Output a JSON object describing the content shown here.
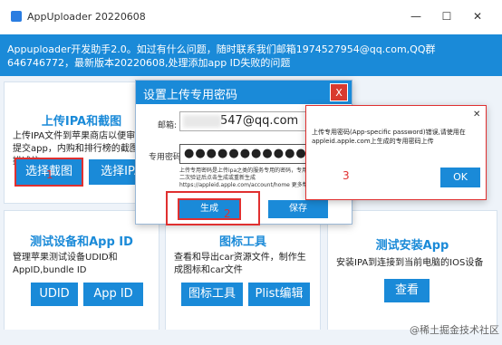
{
  "window": {
    "title": "AppUploader 20220608",
    "minimize": "—",
    "maximize": "☐",
    "close": "✕"
  },
  "banner": {
    "text": "Appuploader开发助手2.0。如过有什么问题，随时联系我们邮箱1974527954@qq.com,QQ群646746772，最新版本20220608,处理添加app ID失败的问题"
  },
  "cards": {
    "upload": {
      "title": "上传IPA和截图",
      "desc": "上传IPA文件到苹果商店以便审核提交app，内购和排行榜的截图和描述信",
      "button_screenshot": "选择截图",
      "button_ipa": "选择IPA"
    },
    "devices": {
      "title": "测试设备和App ID",
      "desc": "管理苹果测试设备UDID和AppID,bundle ID",
      "button_udid": "UDID",
      "button_appid": "App ID"
    },
    "icons": {
      "title": "图标工具",
      "desc": "查看和导出car资源文件，制作生成图标和car文件",
      "button_icon": "图标工具",
      "button_plist": "Plist编辑"
    },
    "install": {
      "title": "测试安装App",
      "desc": "安装IPA到连接到当前电脑的IOS设备",
      "button_view": "查看"
    }
  },
  "password_dialog": {
    "title": "设置上传专用密码",
    "close": "X",
    "email_label": "邮箱:",
    "email_value": "547@qq.com",
    "password_label": "专用密码:",
    "password_value": "●●●●●●●●●●●",
    "note": "上传专用密码是上传ipa之类的服务专用的密码，专用密码可以在开启二次验证后点击生成或重新生成 https://appleid.apple.com/account/home 更多帮助",
    "generate_button": "生成",
    "save_button": "保存"
  },
  "alert": {
    "message": "上传专用密码(App-specific password)错误,请使用在appleid.apple.com上生成的专用密码上传",
    "close": "✕",
    "ok_button": "OK"
  },
  "markers": {
    "one": "1",
    "two": "2",
    "three": "3"
  },
  "watermark": "@稀土掘金技术社区",
  "colors": {
    "accent": "#1a8ad8",
    "highlight": "#e03030"
  }
}
